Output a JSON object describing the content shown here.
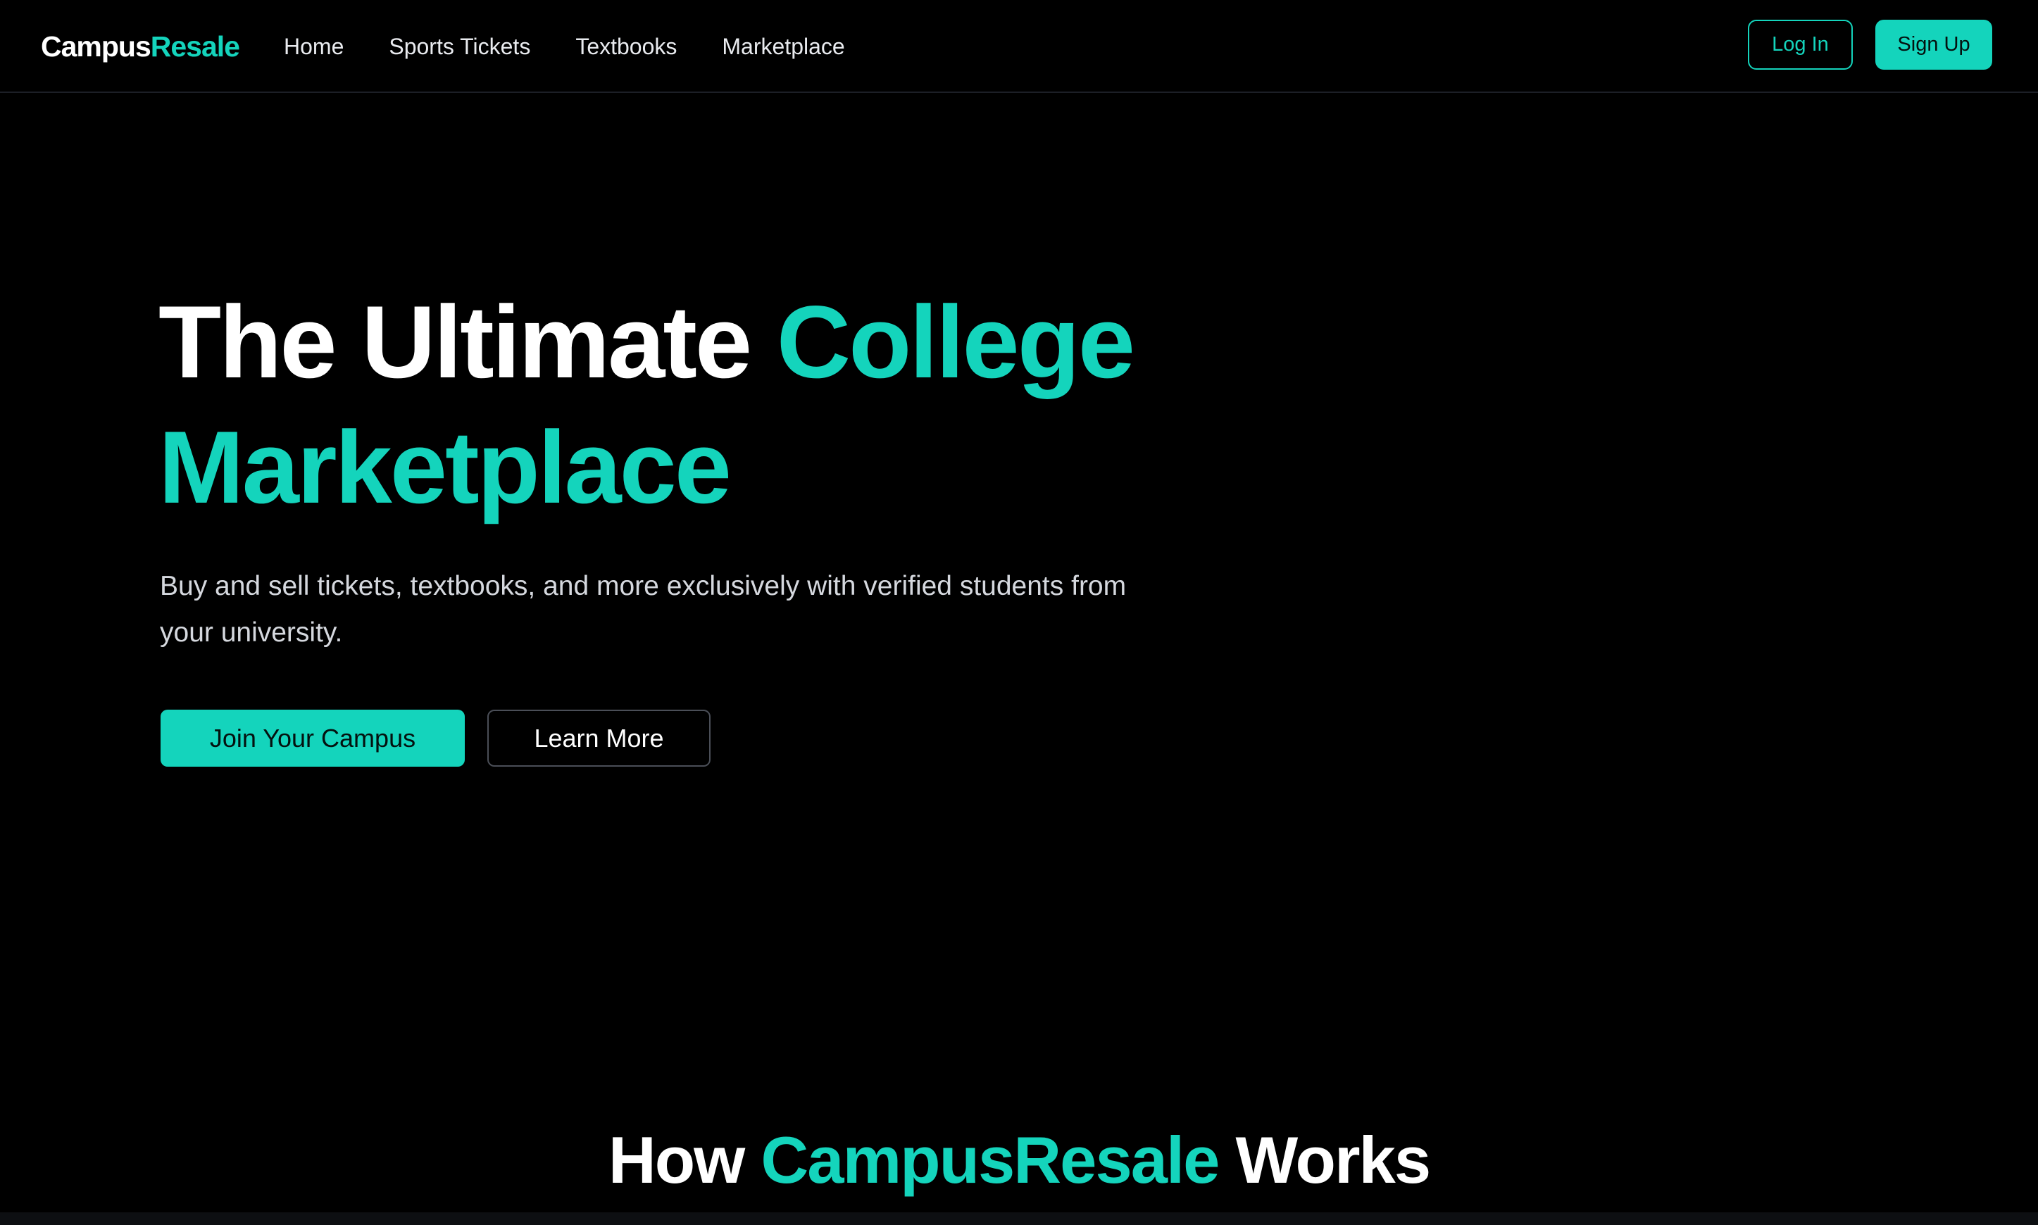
{
  "colors": {
    "background": "#000000",
    "accent": "#14d4bc",
    "text": "#ffffff"
  },
  "nav": {
    "logo_part1": "Campus",
    "logo_part2": "Resale",
    "links": [
      "Home",
      "Sports Tickets",
      "Textbooks",
      "Marketplace"
    ],
    "login_label": "Log In",
    "signup_label": "Sign Up"
  },
  "hero": {
    "title_white": "The Ultimate ",
    "title_teal_1": "College",
    "title_teal_2": "Marketplace",
    "subtitle": "Buy and sell tickets, textbooks, and more exclusively with verified students from your university.",
    "primary_cta": "Join Your Campus",
    "secondary_cta": "Learn More"
  },
  "how_it_works": {
    "title_prefix": "How ",
    "title_brand": "CampusResale",
    "title_suffix": " Works"
  }
}
